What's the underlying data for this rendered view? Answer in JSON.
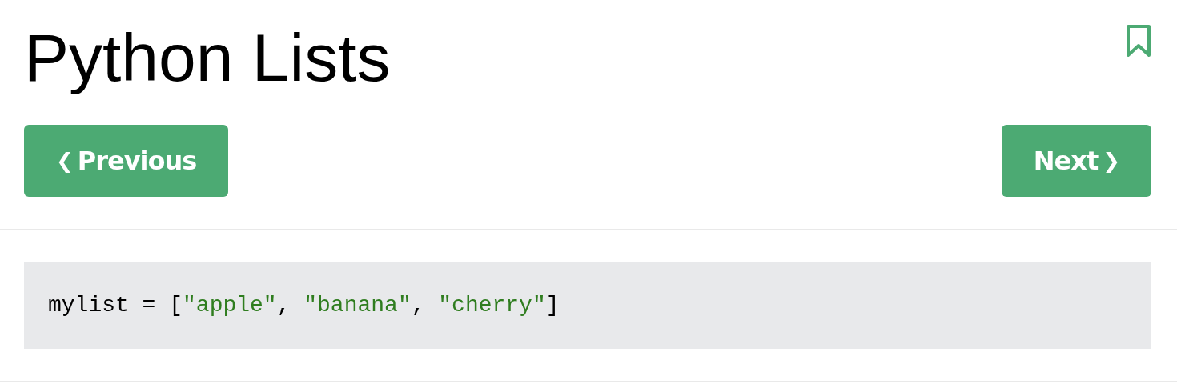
{
  "title": "Python Lists",
  "nav": [
    {
      "kind": "previous",
      "arrow": "❮",
      "label": "Previous"
    },
    {
      "kind": "next",
      "arrow": "❯",
      "label": "Next"
    }
  ],
  "code": [
    {
      "kind": "plain",
      "text": "mylist = ["
    },
    {
      "kind": "string",
      "text": "\"apple\""
    },
    {
      "kind": "plain",
      "text": ", "
    },
    {
      "kind": "string",
      "text": "\"banana\""
    },
    {
      "kind": "plain",
      "text": ", "
    },
    {
      "kind": "string",
      "text": "\"cherry\""
    },
    {
      "kind": "plain",
      "text": "]"
    }
  ]
}
